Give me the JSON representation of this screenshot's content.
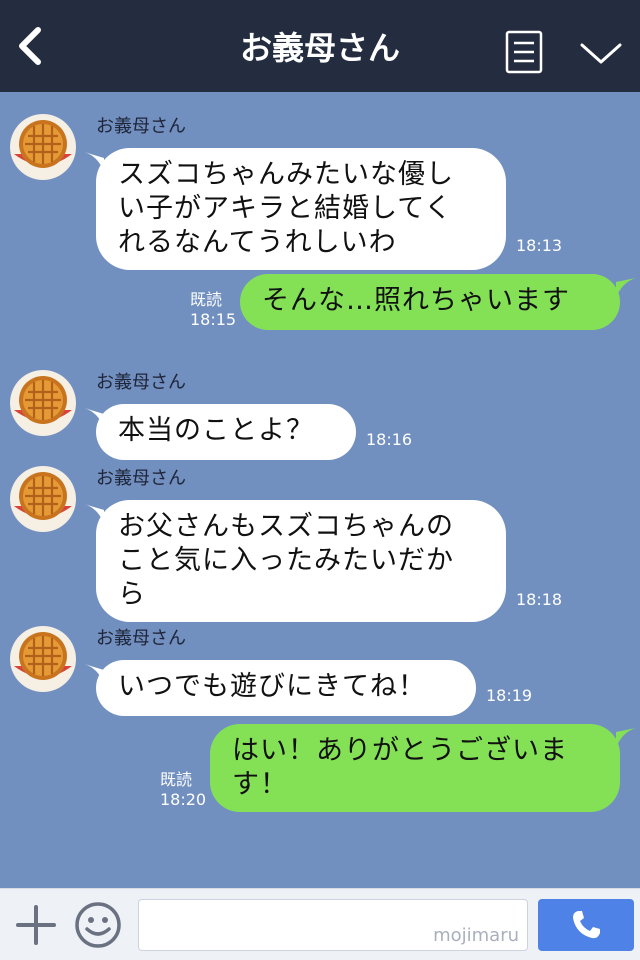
{
  "header": {
    "title": "お義母さん",
    "back_icon": "chevron-left-icon",
    "menu_icon": "menu-icon",
    "more_icon": "chevron-down-icon"
  },
  "messages": [
    {
      "direction": "in",
      "sender": "お義母さん",
      "lines": [
        "スズコちゃんみたいな優し",
        "い子がアキラと結婚してく",
        "れるなんてうれしいわ"
      ],
      "time": "18:13"
    },
    {
      "direction": "out",
      "read": "既読",
      "lines": [
        "そんな…照れちゃいます"
      ],
      "time": "18:15"
    },
    {
      "direction": "in",
      "sender": "お義母さん",
      "lines": [
        "本当のことよ？"
      ],
      "time": "18:16"
    },
    {
      "direction": "in",
      "sender": "お義母さん",
      "lines": [
        "お父さんもスズコちゃんの",
        "こと気に入ったみたいだか",
        "ら"
      ],
      "time": "18:18"
    },
    {
      "direction": "in",
      "sender": "お義母さん",
      "lines": [
        "いつでも遊びにきてね！"
      ],
      "time": "18:19"
    },
    {
      "direction": "out",
      "read": "既読",
      "lines": [
        "はい！ありがとうございま",
        "す！"
      ],
      "time": "18:20"
    }
  ],
  "footer": {
    "input_value": "",
    "watermark": "mojimaru",
    "plus_icon": "plus-icon",
    "smile_icon": "smile-icon",
    "call_icon": "phone-icon"
  },
  "colors": {
    "header_bg": "#242c3f",
    "chat_bg": "#7190c0",
    "incoming_bubble": "#ffffff",
    "outgoing_bubble": "#84e156",
    "call_button": "#4f82e6"
  }
}
